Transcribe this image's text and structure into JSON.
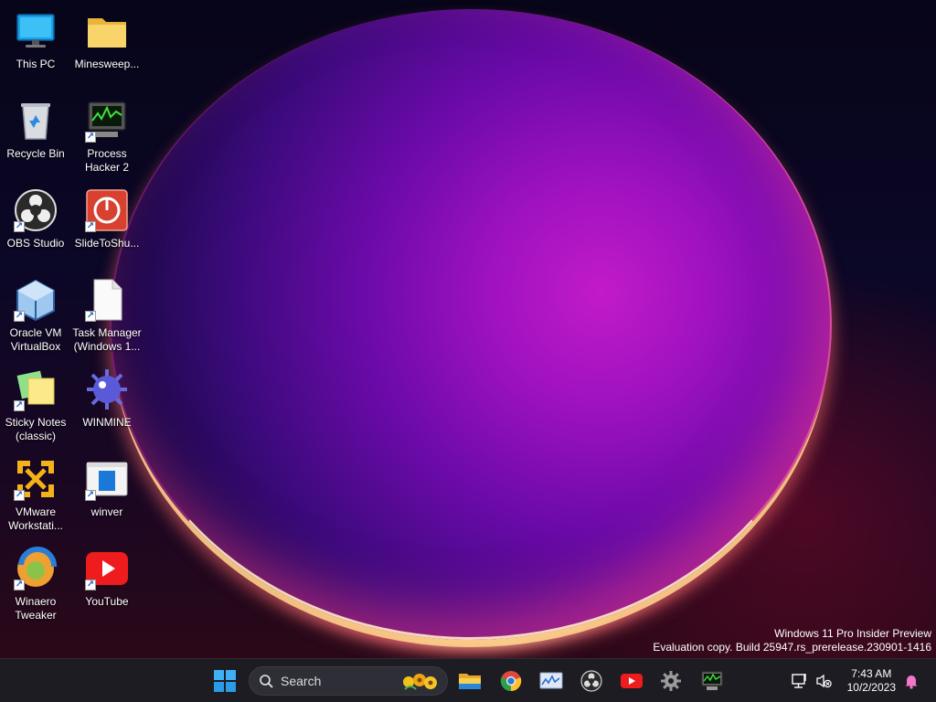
{
  "desktop": {
    "icons": [
      {
        "label": "This PC"
      },
      {
        "label": "Minesweep..."
      },
      {
        "label": "Recycle Bin"
      },
      {
        "label": "Process\nHacker 2"
      },
      {
        "label": "OBS Studio"
      },
      {
        "label": "SlideToShu..."
      },
      {
        "label": "Oracle VM\nVirtualBox"
      },
      {
        "label": "Task Manager\n(Windows 1..."
      },
      {
        "label": "Sticky Notes\n(classic)"
      },
      {
        "label": "WINMINE"
      },
      {
        "label": "VMware\nWorkstati..."
      },
      {
        "label": "winver"
      },
      {
        "label": "Winaero\nTweaker"
      },
      {
        "label": "YouTube"
      }
    ]
  },
  "watermark": {
    "line1": "Windows 11 Pro Insider Preview",
    "line2": "Evaluation copy. Build 25947.rs_prerelease.230901-1416"
  },
  "taskbar": {
    "search_placeholder": "Search",
    "pinned": [
      "start-icon",
      "file-explorer-icon",
      "chrome-icon",
      "resource-monitor-icon",
      "obs-icon",
      "youtube-icon",
      "settings-gear-icon",
      "process-hacker-icon"
    ],
    "clock_time": "7:43 AM",
    "clock_date": "10/2/2023"
  }
}
